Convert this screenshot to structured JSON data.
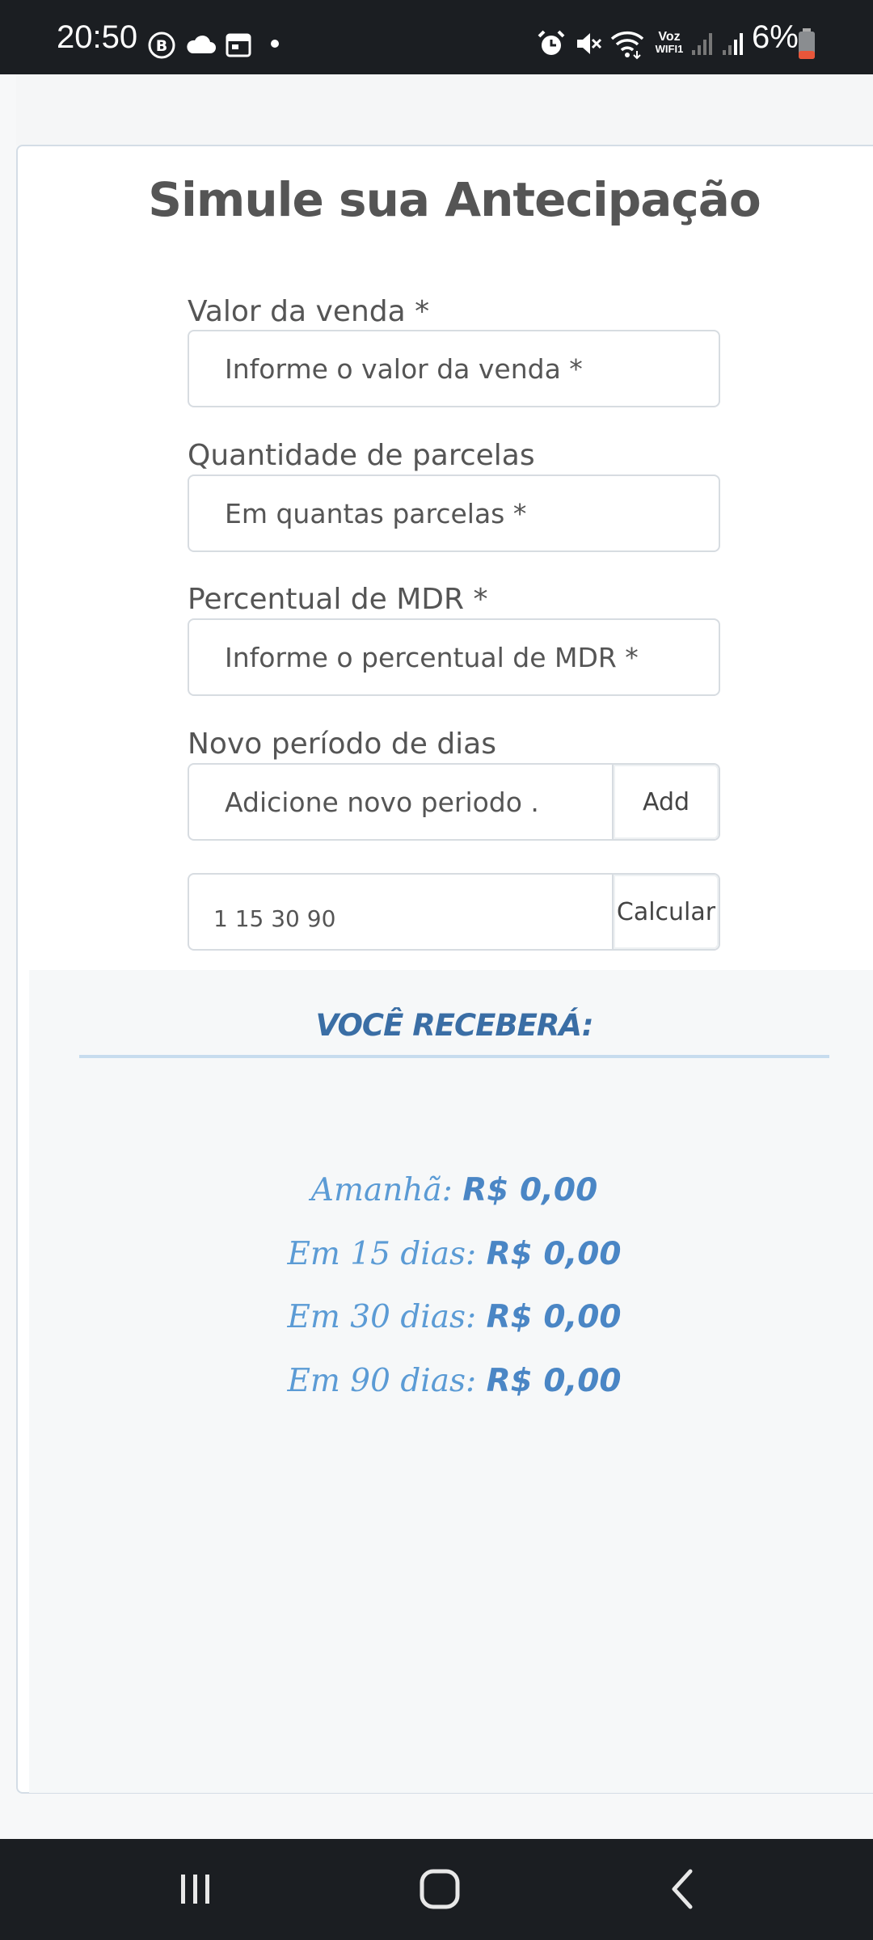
{
  "status_bar": {
    "time": "20:50",
    "battery_percent": "6%",
    "wifi_call_label_top": "Voz",
    "wifi_call_label_bottom": "WIFI1"
  },
  "page": {
    "title": "Simule sua Antecipação"
  },
  "form": {
    "sale_value": {
      "label": "Valor da venda *",
      "placeholder": "Informe o valor da venda *"
    },
    "installments": {
      "label": "Quantidade de parcelas",
      "placeholder": "Em quantas parcelas *"
    },
    "mdr": {
      "label": "Percentual de MDR *",
      "placeholder": "Informe o percentual de MDR *"
    },
    "new_period": {
      "label": "Novo período de dias",
      "placeholder": "Adicione novo periodo .",
      "add_button": "Add"
    },
    "periods": {
      "value": "1 15 30 90",
      "calculate_button": "Calcular"
    }
  },
  "results": {
    "heading": "VOCÊ RECEBERÁ:",
    "rows": [
      {
        "label": "Amanhã:",
        "amount": "R$ 0,00"
      },
      {
        "label": "Em 15 dias:",
        "amount": "R$ 0,00"
      },
      {
        "label": "Em 30 dias:",
        "amount": "R$ 0,00"
      },
      {
        "label": "Em 90 dias:",
        "amount": "R$ 0,00"
      }
    ]
  },
  "colors": {
    "status_bar_bg": "#1b1e22",
    "title_text": "#555555",
    "results_heading": "#3a6ea5",
    "results_text": "#5b9bd5",
    "battery_low": "#e8563a"
  },
  "icons": {
    "status_left": [
      "b-circle-icon",
      "cloud-icon",
      "calendar-icon",
      "dot-icon"
    ],
    "status_right": [
      "alarm-icon",
      "mute-icon",
      "wifi-icon",
      "signal-icon",
      "signal-icon",
      "battery-icon"
    ],
    "nav": [
      "recents-icon",
      "home-icon",
      "back-icon"
    ]
  }
}
